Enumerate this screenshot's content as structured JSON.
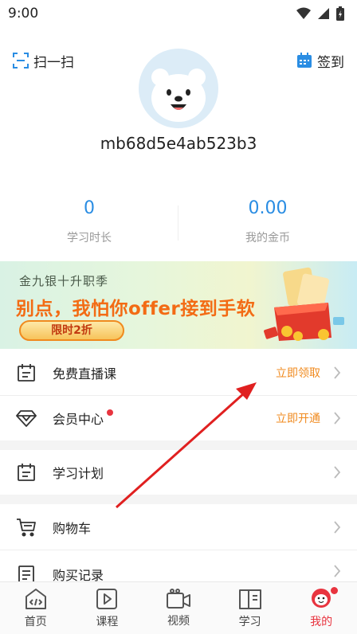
{
  "status_bar": {
    "time": "9:00"
  },
  "header": {
    "scan_label": "扫一扫",
    "signin_label": "签到",
    "username": "mb68d5e4ab523b3"
  },
  "stats": [
    {
      "value": "0",
      "label": "学习时长"
    },
    {
      "value": "0.00",
      "label": "我的金币"
    }
  ],
  "banner": {
    "subtitle": "金九银十升职季",
    "title": "别点，我怕你offer接到手软",
    "button": "限时2折"
  },
  "menu": [
    {
      "label": "免费直播课",
      "action": "立即领取",
      "icon": "calendar-icon"
    },
    {
      "label": "会员中心",
      "action": "立即开通",
      "icon": "diamond-icon",
      "badge": true
    },
    {
      "label": "学习计划",
      "action": "",
      "icon": "calendar-icon"
    },
    {
      "label": "购物车",
      "action": "",
      "icon": "cart-icon"
    },
    {
      "label": "购买记录",
      "action": "",
      "icon": "document-icon"
    }
  ],
  "tabs": [
    {
      "label": "首页",
      "icon": "home-code-icon"
    },
    {
      "label": "课程",
      "icon": "play-icon"
    },
    {
      "label": "视频",
      "icon": "video-camera-icon"
    },
    {
      "label": "学习",
      "icon": "book-icon"
    },
    {
      "label": "我的",
      "icon": "profile-mascot-icon",
      "active": true,
      "badge": true
    }
  ],
  "colors": {
    "accent_blue": "#2a8de3",
    "accent_orange": "#f08a1e",
    "accent_red": "#e8343f",
    "banner_title": "#f36b14"
  }
}
